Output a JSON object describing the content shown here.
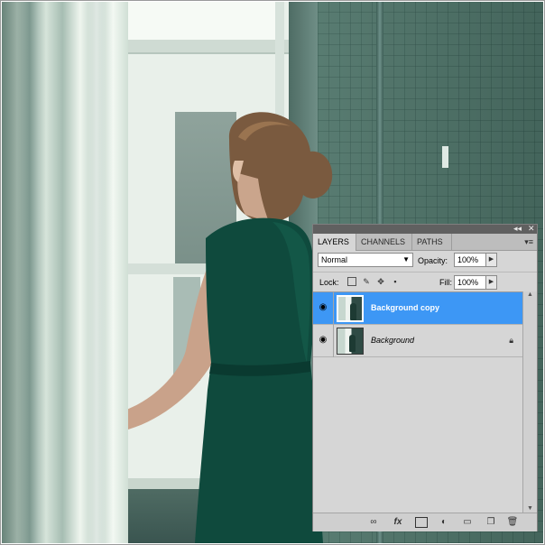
{
  "panel": {
    "collapse_glyph": "◂◂",
    "close_glyph": "✕",
    "menu_glyph": "▾≡",
    "tabs": [
      {
        "label": "LAYERS",
        "active": true
      },
      {
        "label": "CHANNELS",
        "active": false
      },
      {
        "label": "PATHS",
        "active": false
      }
    ],
    "blend_mode": "Normal",
    "opacity_label": "Opacity:",
    "opacity_value": "100%",
    "lock_label": "Lock:",
    "fill_label": "Fill:",
    "fill_value": "100%",
    "layers": [
      {
        "name": "Background copy",
        "visible": true,
        "selected": true,
        "locked": false
      },
      {
        "name": "Background",
        "visible": true,
        "selected": false,
        "locked": true
      }
    ],
    "footer_icons": [
      "link-layers-icon",
      "fx-icon",
      "layer-mask-icon",
      "adjustment-layer-icon",
      "group-folder-icon",
      "new-layer-icon",
      "trash-icon"
    ],
    "fx_glyph": "fx"
  },
  "colors": {
    "selection": "#3d97f5",
    "panel_bg": "#d6d6d6"
  }
}
